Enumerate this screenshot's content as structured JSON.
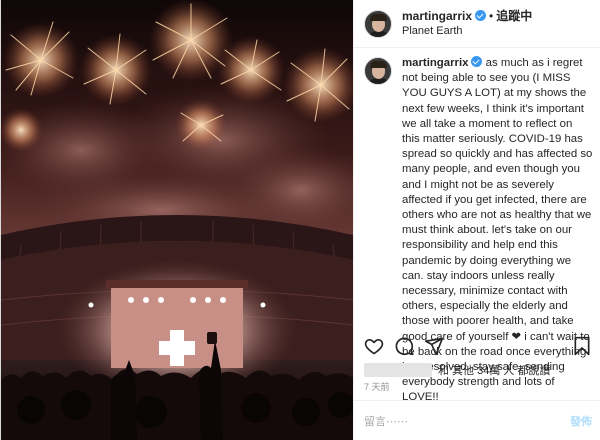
{
  "header": {
    "username": "martingarrix",
    "separator": "•",
    "follow_label": "追蹤中",
    "location": "Planet Earth"
  },
  "caption": {
    "username": "martingarrix",
    "text": "as much as i regret not being able to see you (I MISS YOU GUYS A LOT) at my shows the next few weeks, I think it's important we all take a moment to reflect on this matter seriously. COVID-19 has spread so quickly and has affected so many people, and even though you and I might not be as severely affected if you get infected, there are others who are not as healthy that we must think about. let's take on our responsibility and help end this pandemic by doing everything we can. stay indoors unless really necessary, minimize contact with others, especially the elderly and those with poorer health, and take good care of yourself ❤ i can't wait to be back on the road once everything has resolved. stay safe, sending everybody strength and lots of LOVE!!"
  },
  "likes": {
    "text": "和 其他 34萬 人 都說讚"
  },
  "timestamp": "7 天前",
  "comment_box": {
    "placeholder": "留言⋯⋯",
    "post_label": "發佈"
  },
  "icons": [
    "heart-icon",
    "comment-icon",
    "share-icon",
    "bookmark-icon",
    "verified-icon"
  ],
  "colors": {
    "accent": "#3897f0",
    "post_disabled": "#b2dffc",
    "muted": "#8e8e8e"
  }
}
